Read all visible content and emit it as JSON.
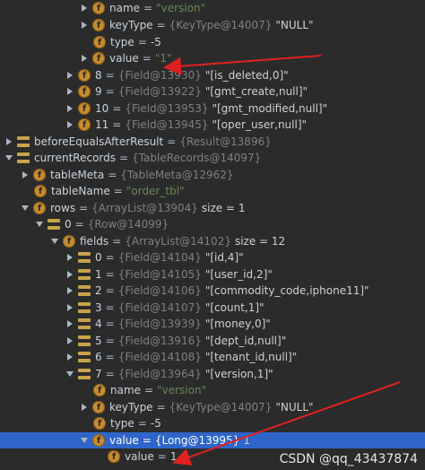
{
  "rows": [
    {
      "name": "name",
      "ref": "",
      "str": "\"version\"",
      "val": ""
    },
    {
      "name": "keyType",
      "ref": "{KeyType@14007}",
      "str": "",
      "val": "\"NULL\""
    },
    {
      "name": "type",
      "ref": "",
      "str": "",
      "val": "-5"
    },
    {
      "name": "value",
      "ref": "",
      "str": "\"1\"",
      "val": ""
    },
    {
      "name": "8",
      "ref": "{Field@13930}",
      "str": "",
      "val": "\"[is_deleted,0]\""
    },
    {
      "name": "9",
      "ref": "{Field@13922}",
      "str": "",
      "val": "\"[gmt_create,null]\""
    },
    {
      "name": "10",
      "ref": "{Field@13953}",
      "str": "",
      "val": "\"[gmt_modified,null]\""
    },
    {
      "name": "11",
      "ref": "{Field@13945}",
      "str": "",
      "val": "\"[oper_user,null]\""
    },
    {
      "name": "beforeEqualsAfterResult",
      "ref": "{Result@13896}",
      "str": "",
      "val": ""
    },
    {
      "name": "currentRecords",
      "ref": "{TableRecords@14097}",
      "str": "",
      "val": ""
    },
    {
      "name": "tableMeta",
      "ref": "{TableMeta@12962}",
      "str": "",
      "val": ""
    },
    {
      "name": "tableName",
      "ref": "",
      "str": "\"order_tbl\"",
      "val": ""
    },
    {
      "name": "rows",
      "ref": "{ArrayList@13904}",
      "str": "",
      "val": "size = 1"
    },
    {
      "name": "0",
      "ref": "{Row@14099}",
      "str": "",
      "val": ""
    },
    {
      "name": "fields",
      "ref": "{ArrayList@14102}",
      "str": "",
      "val": "size = 12"
    },
    {
      "name": "0",
      "ref": "{Field@14104}",
      "str": "",
      "val": "\"[id,4]\""
    },
    {
      "name": "1",
      "ref": "{Field@14105}",
      "str": "",
      "val": "\"[user_id,2]\""
    },
    {
      "name": "2",
      "ref": "{Field@14106}",
      "str": "",
      "val": "\"[commodity_code,iphone11]\""
    },
    {
      "name": "3",
      "ref": "{Field@14107}",
      "str": "",
      "val": "\"[count,1]\""
    },
    {
      "name": "4",
      "ref": "{Field@13939}",
      "str": "",
      "val": "\"[money,0]\""
    },
    {
      "name": "5",
      "ref": "{Field@13916}",
      "str": "",
      "val": "\"[dept_id,null]\""
    },
    {
      "name": "6",
      "ref": "{Field@14108}",
      "str": "",
      "val": "\"[tenant_id,null]\""
    },
    {
      "name": "7",
      "ref": "{Field@13964}",
      "str": "",
      "val": "\"[version,1]\""
    },
    {
      "name": "name",
      "ref": "",
      "str": "\"version\"",
      "val": ""
    },
    {
      "name": "keyType",
      "ref": "{KeyType@14007}",
      "str": "",
      "val": "\"NULL\""
    },
    {
      "name": "type",
      "ref": "",
      "str": "",
      "val": "-5"
    },
    {
      "name": "value",
      "ref": "{Long@13995}",
      "str": "",
      "val": "1"
    },
    {
      "name": "value",
      "ref": "",
      "str": "",
      "val": "1"
    }
  ],
  "watermark": "CSDN @qq_43437874",
  "colors": {
    "background": "#2b2b2b",
    "selection": "#2f65ca",
    "arrow": "#e02020",
    "field_icon": "#c78c2f",
    "string": "#6a8759"
  }
}
